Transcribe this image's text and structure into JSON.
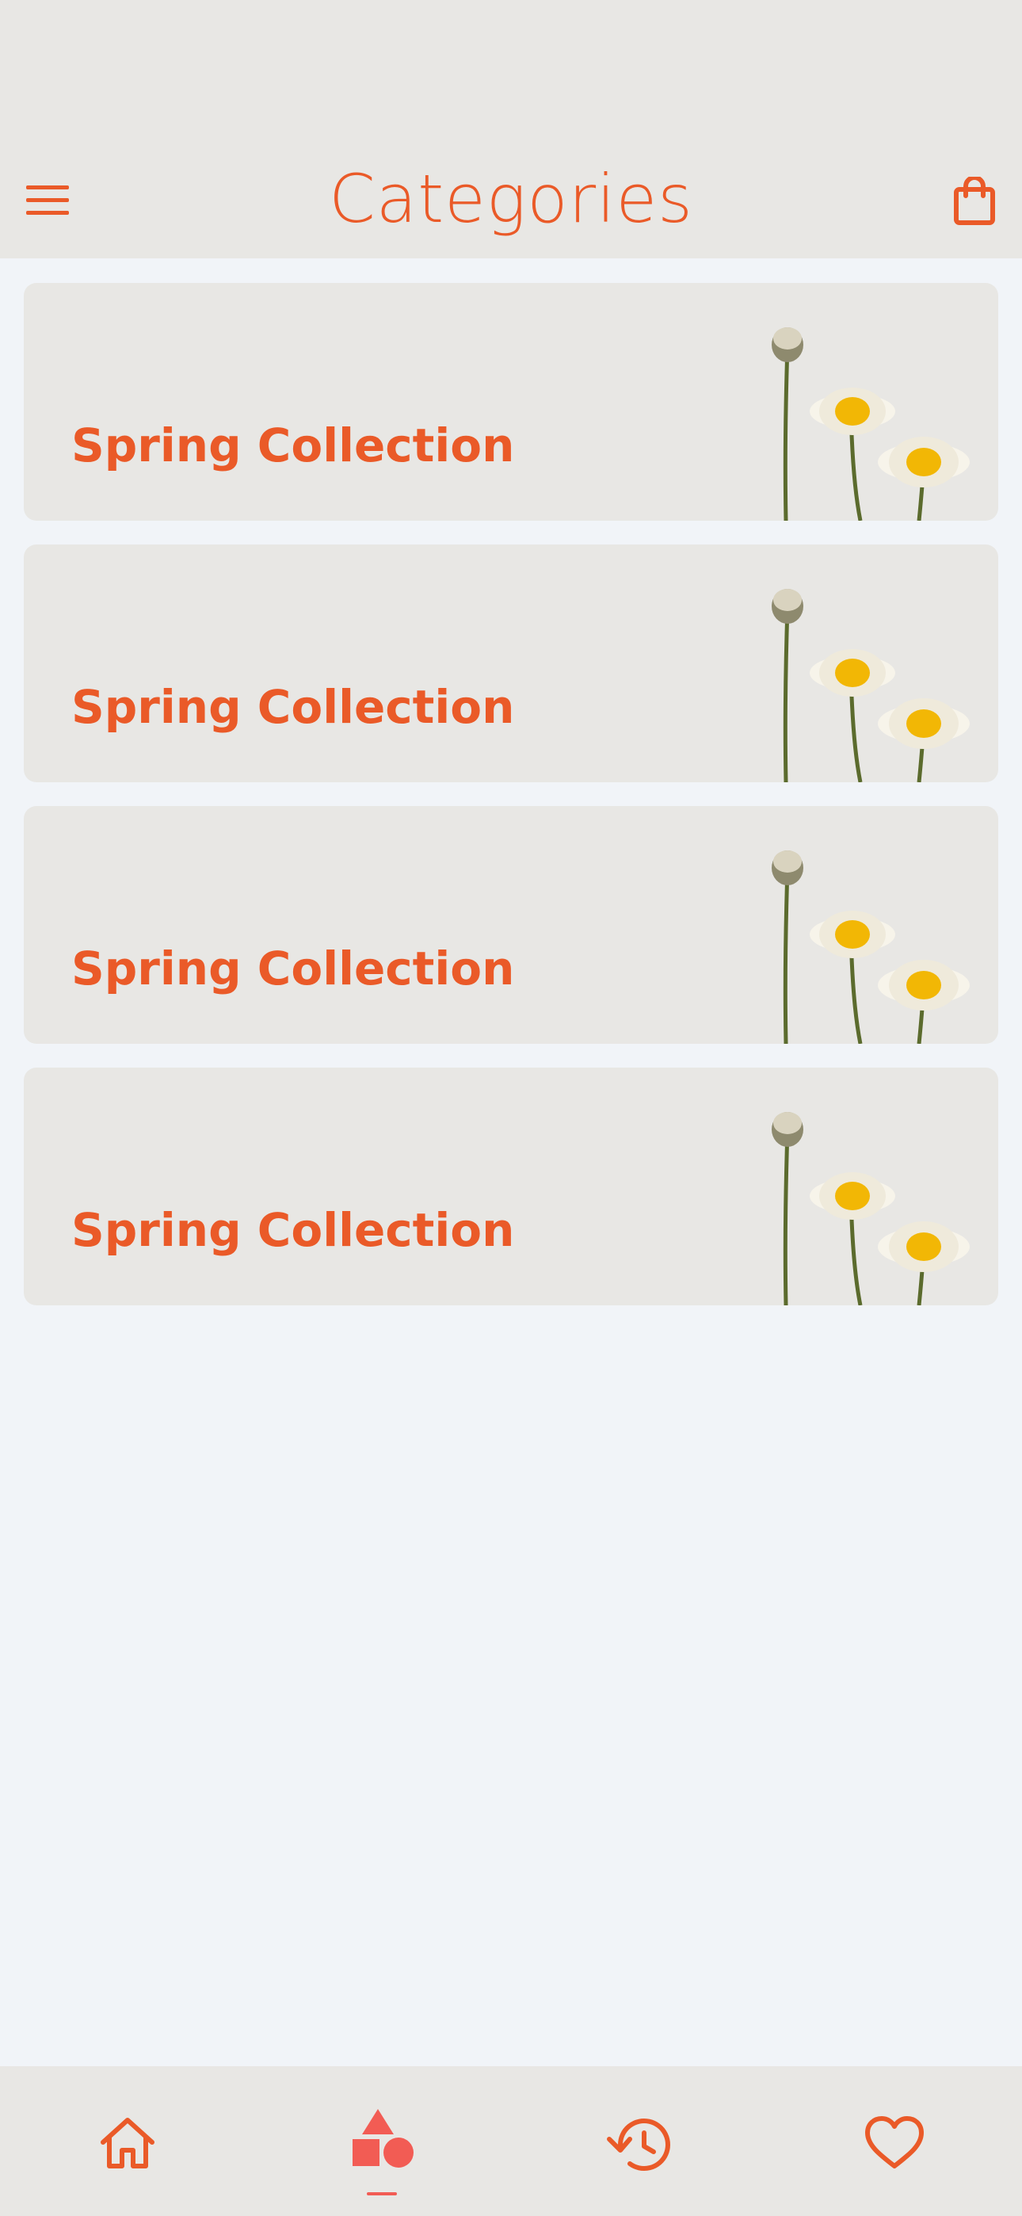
{
  "header": {
    "title": "Categories",
    "menu_icon": "hamburger-menu-icon",
    "cart_icon": "shopping-bag-icon"
  },
  "categories": [
    {
      "title": "Spring Collection",
      "image": "daisy-flowers"
    },
    {
      "title": "Spring Collection",
      "image": "daisy-flowers"
    },
    {
      "title": "Spring Collection",
      "image": "daisy-flowers"
    },
    {
      "title": "Spring Collection",
      "image": "daisy-flowers"
    }
  ],
  "bottom_nav": {
    "items": [
      {
        "icon": "home-icon",
        "active": false
      },
      {
        "icon": "shapes-icon",
        "active": true
      },
      {
        "icon": "history-icon",
        "active": false
      },
      {
        "icon": "heart-icon",
        "active": false
      }
    ]
  },
  "colors": {
    "accent": "#ea5a28",
    "active_nav": "#f25c54",
    "header_bg": "#e8e7e4",
    "page_bg": "#f1f4f8"
  }
}
